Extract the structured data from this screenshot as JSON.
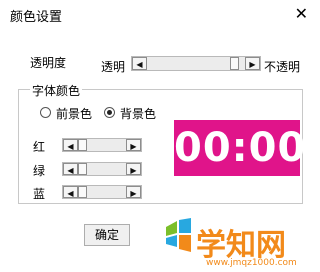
{
  "window": {
    "title": "颜色设置",
    "close_glyph": "✕"
  },
  "opacity": {
    "label": "透明度",
    "left_label": "透明",
    "right_label": "不透明",
    "value_fraction": 0.93
  },
  "font_color": {
    "group_title": "字体颜色",
    "radio_foreground": "前景色",
    "radio_background": "背景色",
    "selected": "背景色",
    "sliders": [
      {
        "label": "红",
        "value_fraction": 0.0
      },
      {
        "label": "绿",
        "value_fraction": 0.0
      },
      {
        "label": "蓝",
        "value_fraction": 0.0
      }
    ]
  },
  "clock": {
    "text": "00:00",
    "background_color": "#e0148a",
    "text_color": "#ffffff"
  },
  "ok_button": {
    "label": "确定"
  },
  "watermark": {
    "brand": "学知网",
    "url": "www.jmqz1000.com"
  }
}
